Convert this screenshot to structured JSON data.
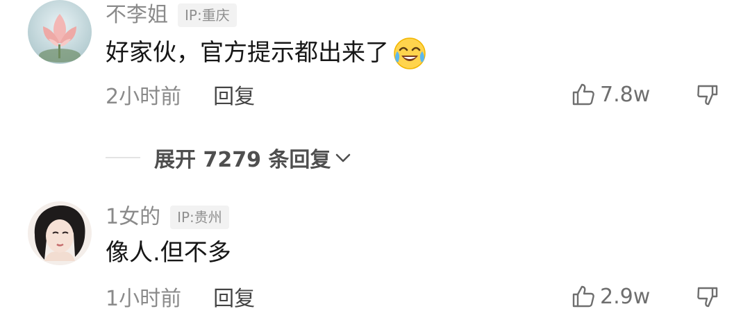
{
  "comments": [
    {
      "username": "不李姐",
      "ip": "IP:重庆",
      "text": "好家伙，官方提示都出来了",
      "emoji": "crying-laughing-emoji",
      "time": "2小时前",
      "reply_label": "回复",
      "likes": "7.8w",
      "avatar": "lotus-flower-avatar"
    },
    {
      "username": "1女的",
      "ip": "IP:贵州",
      "text": "像人.但不多",
      "time": "1小时前",
      "reply_label": "回复",
      "likes": "2.9w",
      "avatar": "drawn-woman-portrait-avatar"
    }
  ],
  "expand_replies": {
    "label": "展开 7279 条回复"
  },
  "icons": {
    "like": "thumbs-up-icon",
    "dislike": "thumbs-down-icon",
    "expand": "chevron-down-icon"
  },
  "colors": {
    "text_primary": "#161616",
    "text_secondary": "#8a8a8a",
    "badge_bg": "#f2f2f2"
  }
}
